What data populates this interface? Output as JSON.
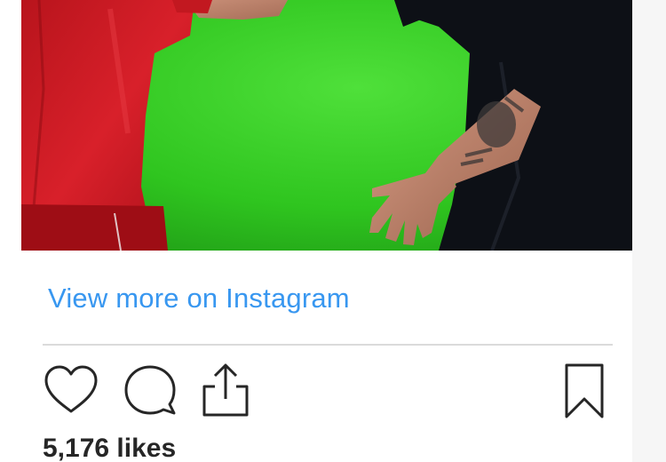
{
  "post": {
    "image_alt": "Photo of a player in a red kit and a tattooed man in black shaking hands on a football pitch",
    "view_more_label": "View more on Instagram",
    "likes_text": "5,176 likes"
  },
  "actions": [
    {
      "name": "like",
      "icon": "heart-icon"
    },
    {
      "name": "comment",
      "icon": "speech-bubble-icon"
    },
    {
      "name": "share",
      "icon": "share-upload-icon"
    },
    {
      "name": "save",
      "icon": "bookmark-icon"
    }
  ],
  "colors": {
    "link": "#3897f0",
    "divider": "#dbdbdb",
    "text": "#262626",
    "icon_stroke": "#262626"
  }
}
